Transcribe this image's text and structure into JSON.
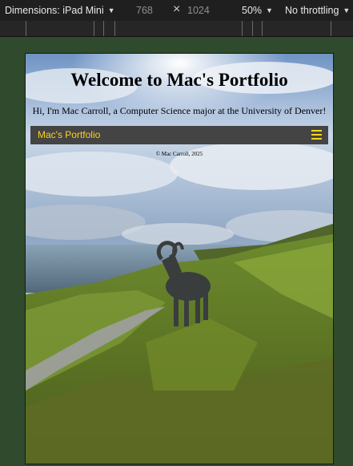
{
  "devtools": {
    "dimensions_label": "Dimensions: iPad Mini",
    "width": "768",
    "height": "1024",
    "zoom": "50%",
    "throttling": "No throttling"
  },
  "page": {
    "title": "Welcome to Mac's Portfolio",
    "subtitle": "Hi, I'm Mac Carroll, a Computer Science major at the University of Denver!",
    "nav_brand": "Mac's Portfolio",
    "footer": "© Mac Carroll, 2025"
  },
  "colors": {
    "accent": "#ffd21a",
    "navbar_bg": "#444444",
    "devtools_bg": "#1f1f1f",
    "backdrop": "#2f4a2c"
  },
  "icons": {
    "menu": "hamburger-menu-icon",
    "dropdown": "triangle-down-icon",
    "swap": "close-icon"
  }
}
